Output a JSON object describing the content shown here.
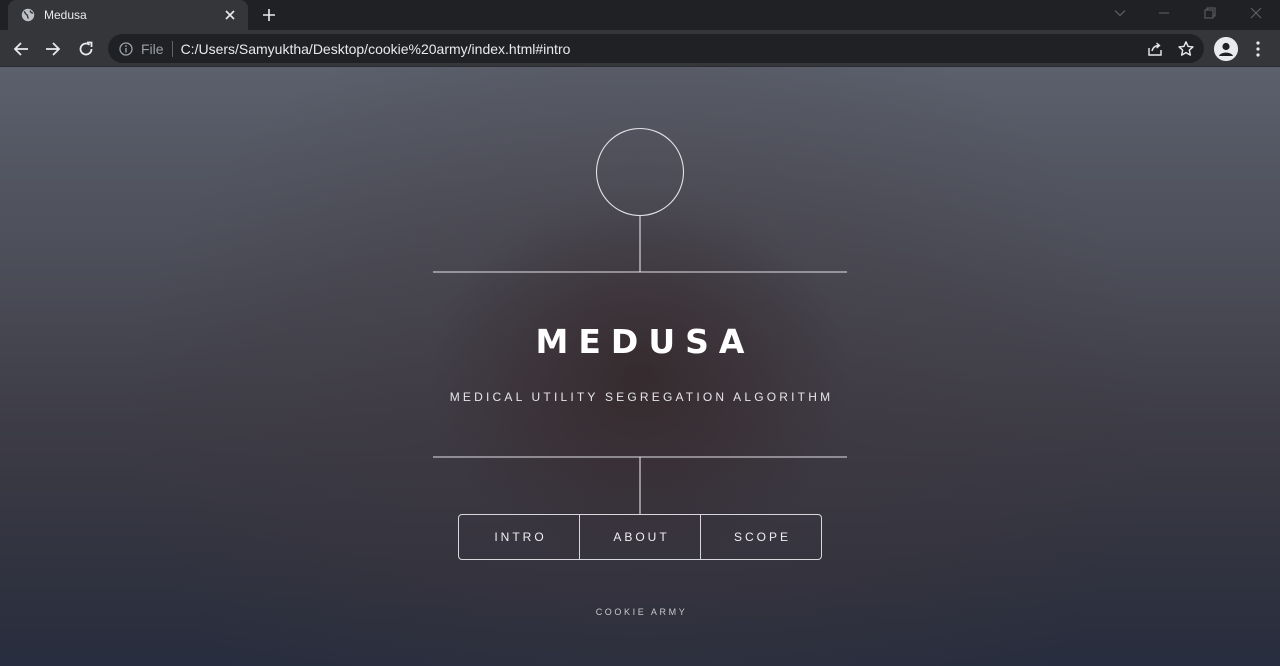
{
  "browser": {
    "tab_title": "Medusa",
    "url_scheme_label": "File",
    "url": "C:/Users/Samyuktha/Desktop/cookie%20army/index.html#intro"
  },
  "page": {
    "title": "MEDUSA",
    "subtitle": "MEDICAL UTILITY SEGREGATION ALGORITHM",
    "nav": [
      {
        "label": "INTRO"
      },
      {
        "label": "ABOUT"
      },
      {
        "label": "SCOPE"
      }
    ],
    "footer": "COOKIE ARMY"
  }
}
